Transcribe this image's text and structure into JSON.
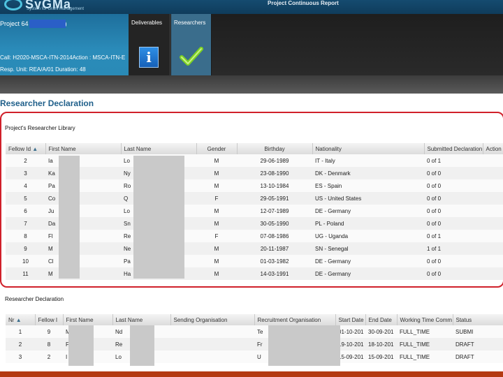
{
  "topbar": {
    "logo_text": "SyGMa",
    "logo_sub": "System for Grant Management",
    "app_title": "Project Continuous Report"
  },
  "project": {
    "name_prefix": "Project 64",
    "name_suffix": ")",
    "call_line": "Call: H2020-MSCA-ITN-2014Action : MSCA-ITN-E",
    "resp_line": "Resp. Unit: REA/A/01      Duration: 48"
  },
  "tabs": [
    {
      "label": "Deliverables",
      "icon": "info-icon"
    },
    {
      "label": "Researchers",
      "icon": "check-icon"
    }
  ],
  "page_title": "Researcher Declaration",
  "library": {
    "title": "Project's Researcher Library",
    "columns": [
      "Fellow Id",
      "First Name",
      "Last Name",
      "Gender",
      "Birthday",
      "Nationality",
      "Submitted Declaration",
      "Action"
    ],
    "rows": [
      {
        "id": "2",
        "first": "Ia",
        "last": "Lo",
        "gender": "M",
        "birthday": "29-06-1989",
        "nationality": "IT - Italy",
        "submitted": "0 of 1"
      },
      {
        "id": "3",
        "first": "Ka",
        "last": "Ny",
        "gender": "M",
        "birthday": "23-08-1990",
        "nationality": "DK - Denmark",
        "submitted": "0 of 0"
      },
      {
        "id": "4",
        "first": "Pa",
        "last": "Ro",
        "gender": "M",
        "birthday": "13-10-1984",
        "nationality": "ES - Spain",
        "submitted": "0 of 0"
      },
      {
        "id": "5",
        "first": "Co",
        "last": "Q",
        "gender": "F",
        "birthday": "29-05-1991",
        "nationality": "US - United States",
        "submitted": "0 of 0"
      },
      {
        "id": "6",
        "first": "Ju",
        "last": "Lo",
        "gender": "M",
        "birthday": "12-07-1989",
        "nationality": "DE - Germany",
        "submitted": "0 of 0"
      },
      {
        "id": "7",
        "first": "Da",
        "last": "Sn",
        "gender": "M",
        "birthday": "30-05-1990",
        "nationality": "PL - Poland",
        "submitted": "0 of 0"
      },
      {
        "id": "8",
        "first": "Fl",
        "last": "Re",
        "gender": "F",
        "birthday": "07-08-1986",
        "nationality": "UG - Uganda",
        "submitted": "0 of 1"
      },
      {
        "id": "9",
        "first": "M",
        "last": "Ne",
        "gender": "M",
        "birthday": "20-11-1987",
        "nationality": "SN - Senegal",
        "submitted": "1 of 1"
      },
      {
        "id": "10",
        "first": "Cl",
        "last": "Pa",
        "gender": "M",
        "birthday": "01-03-1982",
        "nationality": "DE - Germany",
        "submitted": "0 of 0"
      },
      {
        "id": "11",
        "first": "M",
        "last": "Ha",
        "gender": "M",
        "birthday": "14-03-1991",
        "nationality": "DE - Germany",
        "submitted": "0 of 0"
      }
    ]
  },
  "declaration": {
    "title": "Researcher Declaration",
    "columns": [
      "Nr",
      "Fellow I",
      "First Name",
      "Last Name",
      "Sending Organisation",
      "Recruitment Organisation",
      "Start Date",
      "End Date",
      "Working Time Comm",
      "Status"
    ],
    "rows": [
      {
        "nr": "1",
        "fellow": "9",
        "first": "M",
        "last": "Nd",
        "sending": "",
        "recruit": "Te",
        "start": "01-10-201",
        "end": "30-09-201",
        "wtc": "FULL_TIME",
        "status": "SUBMI"
      },
      {
        "nr": "2",
        "fellow": "8",
        "first": "F",
        "last": "Re",
        "sending": "",
        "recruit": "Fr",
        "start": "19-10-201",
        "end": "18-10-201",
        "wtc": "FULL_TIME",
        "status": "DRAFT"
      },
      {
        "nr": "3",
        "fellow": "2",
        "first": "I",
        "last": "Lo",
        "sending": "",
        "recruit": "U",
        "start": "15-09-201",
        "end": "15-09-201",
        "wtc": "FULL_TIME",
        "status": "DRAFT"
      }
    ]
  },
  "colors": {
    "accent": "#1f5f8a",
    "highlight": "#d0202a",
    "header_blue": "#2b8cba"
  }
}
